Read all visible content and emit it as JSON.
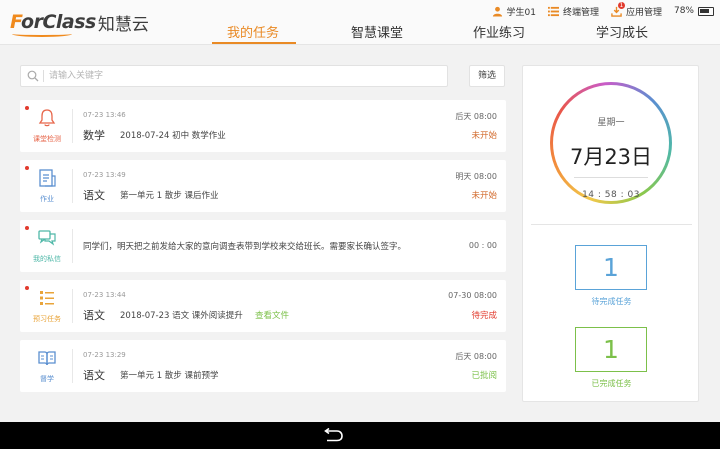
{
  "brand": {
    "logo_en": "ForClass",
    "logo_cn": "知慧云"
  },
  "status": {
    "user": "学生01",
    "device_mgmt": "终端管理",
    "app_mgmt": "应用管理",
    "app_badge": "1",
    "battery": "78%"
  },
  "nav": {
    "tabs": [
      "我的任务",
      "智慧课堂",
      "作业练习",
      "学习成长"
    ],
    "active": 0
  },
  "search": {
    "placeholder": "请输入关键字"
  },
  "filter_label": "筛选",
  "colors": {
    "accent": "#e98a25",
    "red": "#e23b2e",
    "green": "#7cc04a",
    "blue": "#5aa3d8"
  },
  "tasks": [
    {
      "type_label": "课堂检测",
      "icon": "bell-icon",
      "time": "07-23 13:46",
      "subject": "数学",
      "desc": "2018-07-24 初中 数学作业",
      "link": "",
      "due": "后天 08:00",
      "status": "未开始",
      "status_color": "#d26a2c",
      "icon_color": "#e7664a"
    },
    {
      "type_label": "作业",
      "icon": "document-icon",
      "time": "07-23 13:49",
      "subject": "语文",
      "desc": "第一单元 1 散步 课后作业",
      "link": "",
      "due": "明天 08:00",
      "status": "未开始",
      "status_color": "#d26a2c",
      "icon_color": "#5a8fd0"
    },
    {
      "type_label": "我的私信",
      "icon": "chat-icon",
      "message": "同学们，明天把之前发给大家的意向调查表带到学校来交给班长。需要家长确认签字。",
      "due": "00 : 00",
      "icon_color": "#4fb8a8"
    },
    {
      "type_label": "预习任务",
      "icon": "list-icon",
      "time": "07-23 13:44",
      "subject": "语文",
      "desc": "2018-07-23 语文 课外阅读提升",
      "link": "查看文件",
      "due": "07-30 08:00",
      "status": "待完成",
      "status_color": "#e23b2e",
      "icon_color": "#e9a43a"
    },
    {
      "type_label": "督学",
      "icon": "book-icon",
      "time": "07-23 13:29",
      "subject": "语文",
      "desc": "第一单元 1 散步 课前预学",
      "link": "",
      "due": "后天 08:00",
      "status": "已批阅",
      "status_color": "#7cc04a",
      "icon_color": "#5a8fd0"
    }
  ],
  "calendar": {
    "weekday": "星期一",
    "date": "7月23日",
    "time": "14 : 58 : 03"
  },
  "summary": {
    "pending_count": "1",
    "pending_label": "待完成任务",
    "done_count": "1",
    "done_label": "已完成任务"
  }
}
